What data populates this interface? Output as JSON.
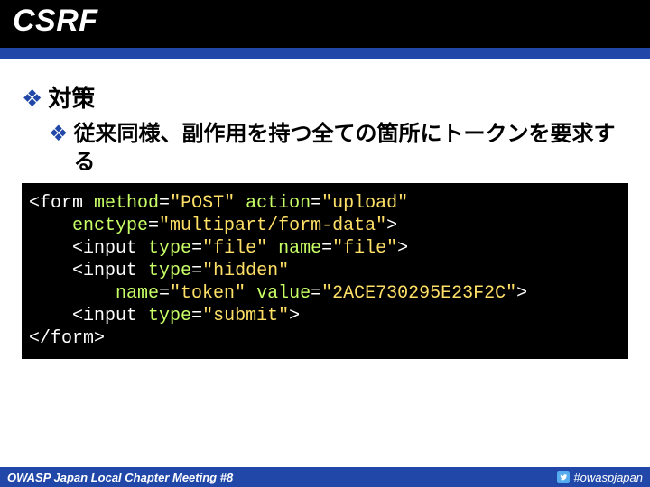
{
  "title": "CSRF",
  "bullets": {
    "l1": "対策",
    "l2": "従来同様、副作用を持つ全ての箇所にトークンを要求する"
  },
  "code": {
    "tag_open": "<form",
    "attr_method": "method",
    "val_method": "\"POST\"",
    "attr_action": "action",
    "val_action": "\"upload\"",
    "attr_enctype": "enctype",
    "val_enctype": "\"multipart/form-data\"",
    "gt": ">",
    "tag_input": "<input",
    "attr_type": "type",
    "val_file": "\"file\"",
    "attr_name": "name",
    "val_namefile": "\"file\"",
    "val_hidden": "\"hidden\"",
    "val_token": "\"token\"",
    "attr_value": "value",
    "val_tokenval": "\"2ACE730295E23F2C\"",
    "val_submit": "\"submit\"",
    "tag_close": "</form>",
    "eq": "=",
    "sp": " ",
    "indent1": "    ",
    "indent2": "        "
  },
  "footer": {
    "left": "OWASP Japan Local Chapter Meeting #8",
    "hashtag": "#owaspjapan"
  }
}
